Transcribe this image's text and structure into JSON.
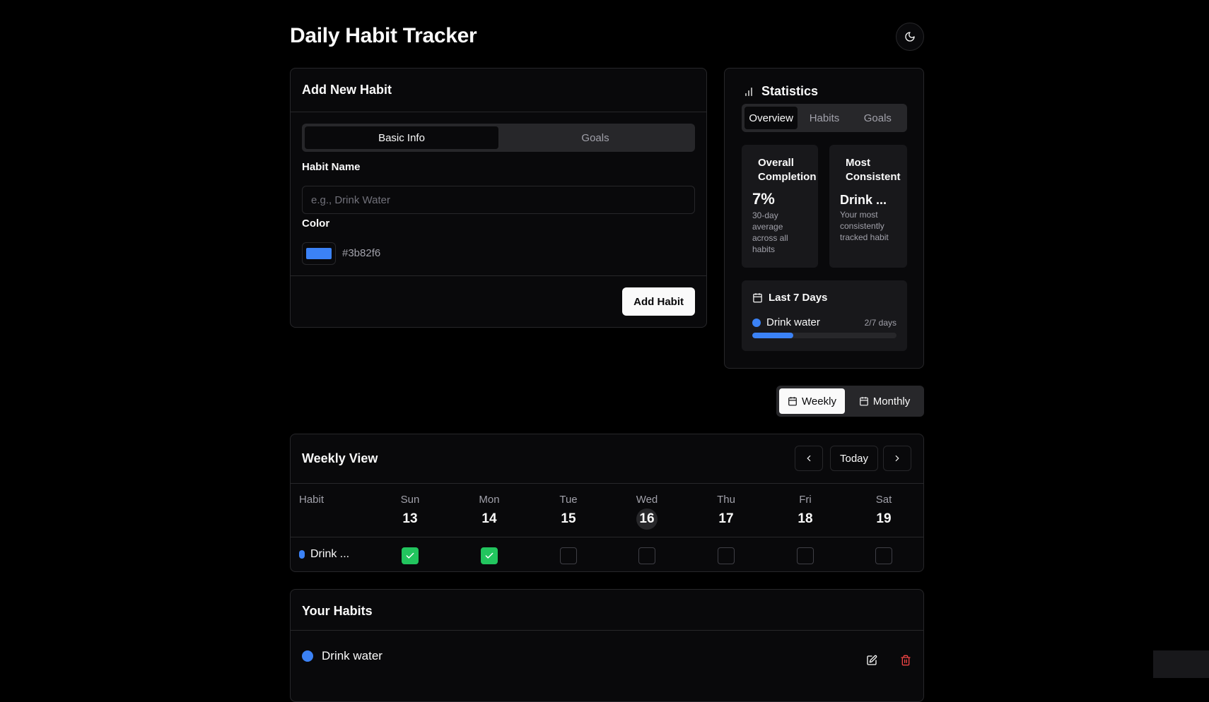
{
  "app": {
    "title": "Daily Habit Tracker"
  },
  "add_habit": {
    "title": "Add New Habit",
    "tabs": [
      {
        "label": "Basic Info",
        "active": true
      },
      {
        "label": "Goals",
        "active": false
      }
    ],
    "name_label": "Habit Name",
    "name_placeholder": "e.g., Drink Water",
    "name_value": "",
    "color_label": "Color",
    "color_value": "#3b82f6",
    "submit_label": "Add Habit"
  },
  "statistics": {
    "title": "Statistics",
    "tabs": [
      {
        "label": "Overview",
        "active": true
      },
      {
        "label": "Habits",
        "active": false
      },
      {
        "label": "Goals",
        "active": false
      }
    ],
    "overall": {
      "title": "Overall Completion",
      "value": "7%",
      "desc": "30-day average across all habits"
    },
    "consistent": {
      "title": "Most Consistent",
      "value": "Drink ...",
      "desc": "Your most consistently tracked habit"
    },
    "last7": {
      "title": "Last 7 Days",
      "items": [
        {
          "name": "Drink water",
          "count": "2/7 days",
          "fraction": 0.2857,
          "color": "#3b82f6"
        }
      ]
    }
  },
  "view_toggle": {
    "weekly": "Weekly",
    "monthly": "Monthly",
    "selected": "weekly"
  },
  "weekly": {
    "title": "Weekly View",
    "today_label": "Today",
    "habit_header": "Habit",
    "days": [
      {
        "name": "Sun",
        "date": "13",
        "today": false
      },
      {
        "name": "Mon",
        "date": "14",
        "today": false
      },
      {
        "name": "Tue",
        "date": "15",
        "today": false
      },
      {
        "name": "Wed",
        "date": "16",
        "today": true
      },
      {
        "name": "Thu",
        "date": "17",
        "today": false
      },
      {
        "name": "Fri",
        "date": "18",
        "today": false
      },
      {
        "name": "Sat",
        "date": "19",
        "today": false
      }
    ],
    "rows": [
      {
        "name": "Drink ...",
        "color": "#3b82f6",
        "checks": [
          true,
          true,
          false,
          false,
          false,
          false,
          false
        ]
      }
    ]
  },
  "your_habits": {
    "title": "Your Habits",
    "items": [
      {
        "name": "Drink water",
        "color": "#3b82f6"
      }
    ]
  },
  "colors": {
    "accent": "#3b82f6",
    "success": "#22c55e",
    "danger": "#ef4444"
  }
}
